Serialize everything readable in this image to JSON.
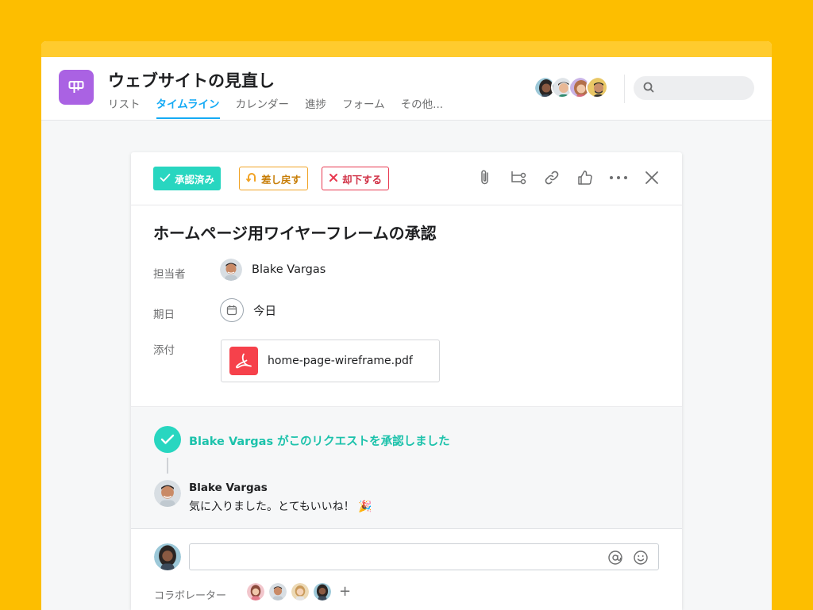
{
  "project": {
    "title": "ウェブサイトの見直し",
    "icon": "board-icon",
    "color": "#AA62E3"
  },
  "tabs": [
    {
      "label": "リスト",
      "active": false
    },
    {
      "label": "タイムライン",
      "active": true
    },
    {
      "label": "カレンダー",
      "active": false
    },
    {
      "label": "進捗",
      "active": false
    },
    {
      "label": "フォーム",
      "active": false
    },
    {
      "label": "その他...",
      "active": false
    }
  ],
  "search": {
    "placeholder": ""
  },
  "toolbar": {
    "approved_label": "承認済み",
    "revise_label": "差し戻す",
    "reject_label": "却下する"
  },
  "task": {
    "title": "ホームページ用ワイヤーフレームの承認",
    "assignee_label": "担当者",
    "assignee_name": "Blake Vargas",
    "due_label": "期日",
    "due_value": "今日",
    "attachment_label": "添付",
    "attachment_name": "home-page-wireframe.pdf"
  },
  "activity": {
    "story": "Blake Vargas がこのリクエストを承認しました",
    "comment_author": "Blake Vargas",
    "comment_text": "気に入りました。とてもいいね！ 🎉"
  },
  "composer": {
    "placeholder": "",
    "collaborators_label": "コラボレーター",
    "add_label": "+"
  },
  "colors": {
    "background": "#FDBE00",
    "accent": "#14AAF5",
    "approved": "#28d6c0",
    "revise": "#F1A325",
    "reject": "#E8384F"
  }
}
